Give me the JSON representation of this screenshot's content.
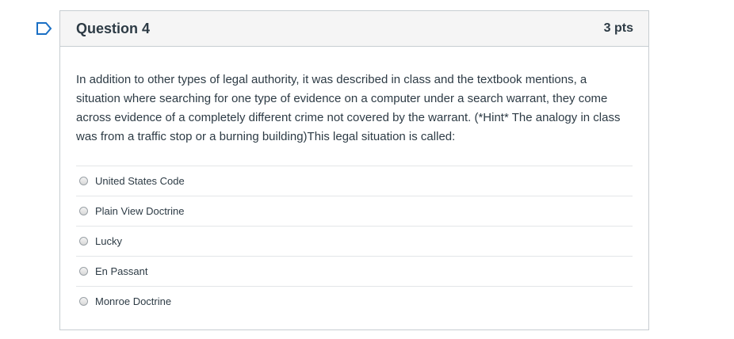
{
  "question": {
    "title": "Question 4",
    "points": "3 pts",
    "text": "In addition to other types of legal authority, it was described in class and the textbook mentions, a situation where searching for one type of evidence on a computer under a search warrant, they come across evidence of a completely different crime not covered by the warrant.  (*Hint* The analogy in class was from a traffic stop or a burning building)This legal situation is called:",
    "answers": [
      {
        "label": "United States Code"
      },
      {
        "label": "Plain View Doctrine"
      },
      {
        "label": "Lucky"
      },
      {
        "label": "En Passant"
      },
      {
        "label": "Monroe Doctrine"
      }
    ]
  },
  "icons": {
    "flag": "bookmark-flag-icon"
  },
  "colors": {
    "flag_outline": "#1a6fc4",
    "header_background": "#f5f5f5",
    "text": "#2d3b45",
    "border": "#c7cdd1"
  }
}
